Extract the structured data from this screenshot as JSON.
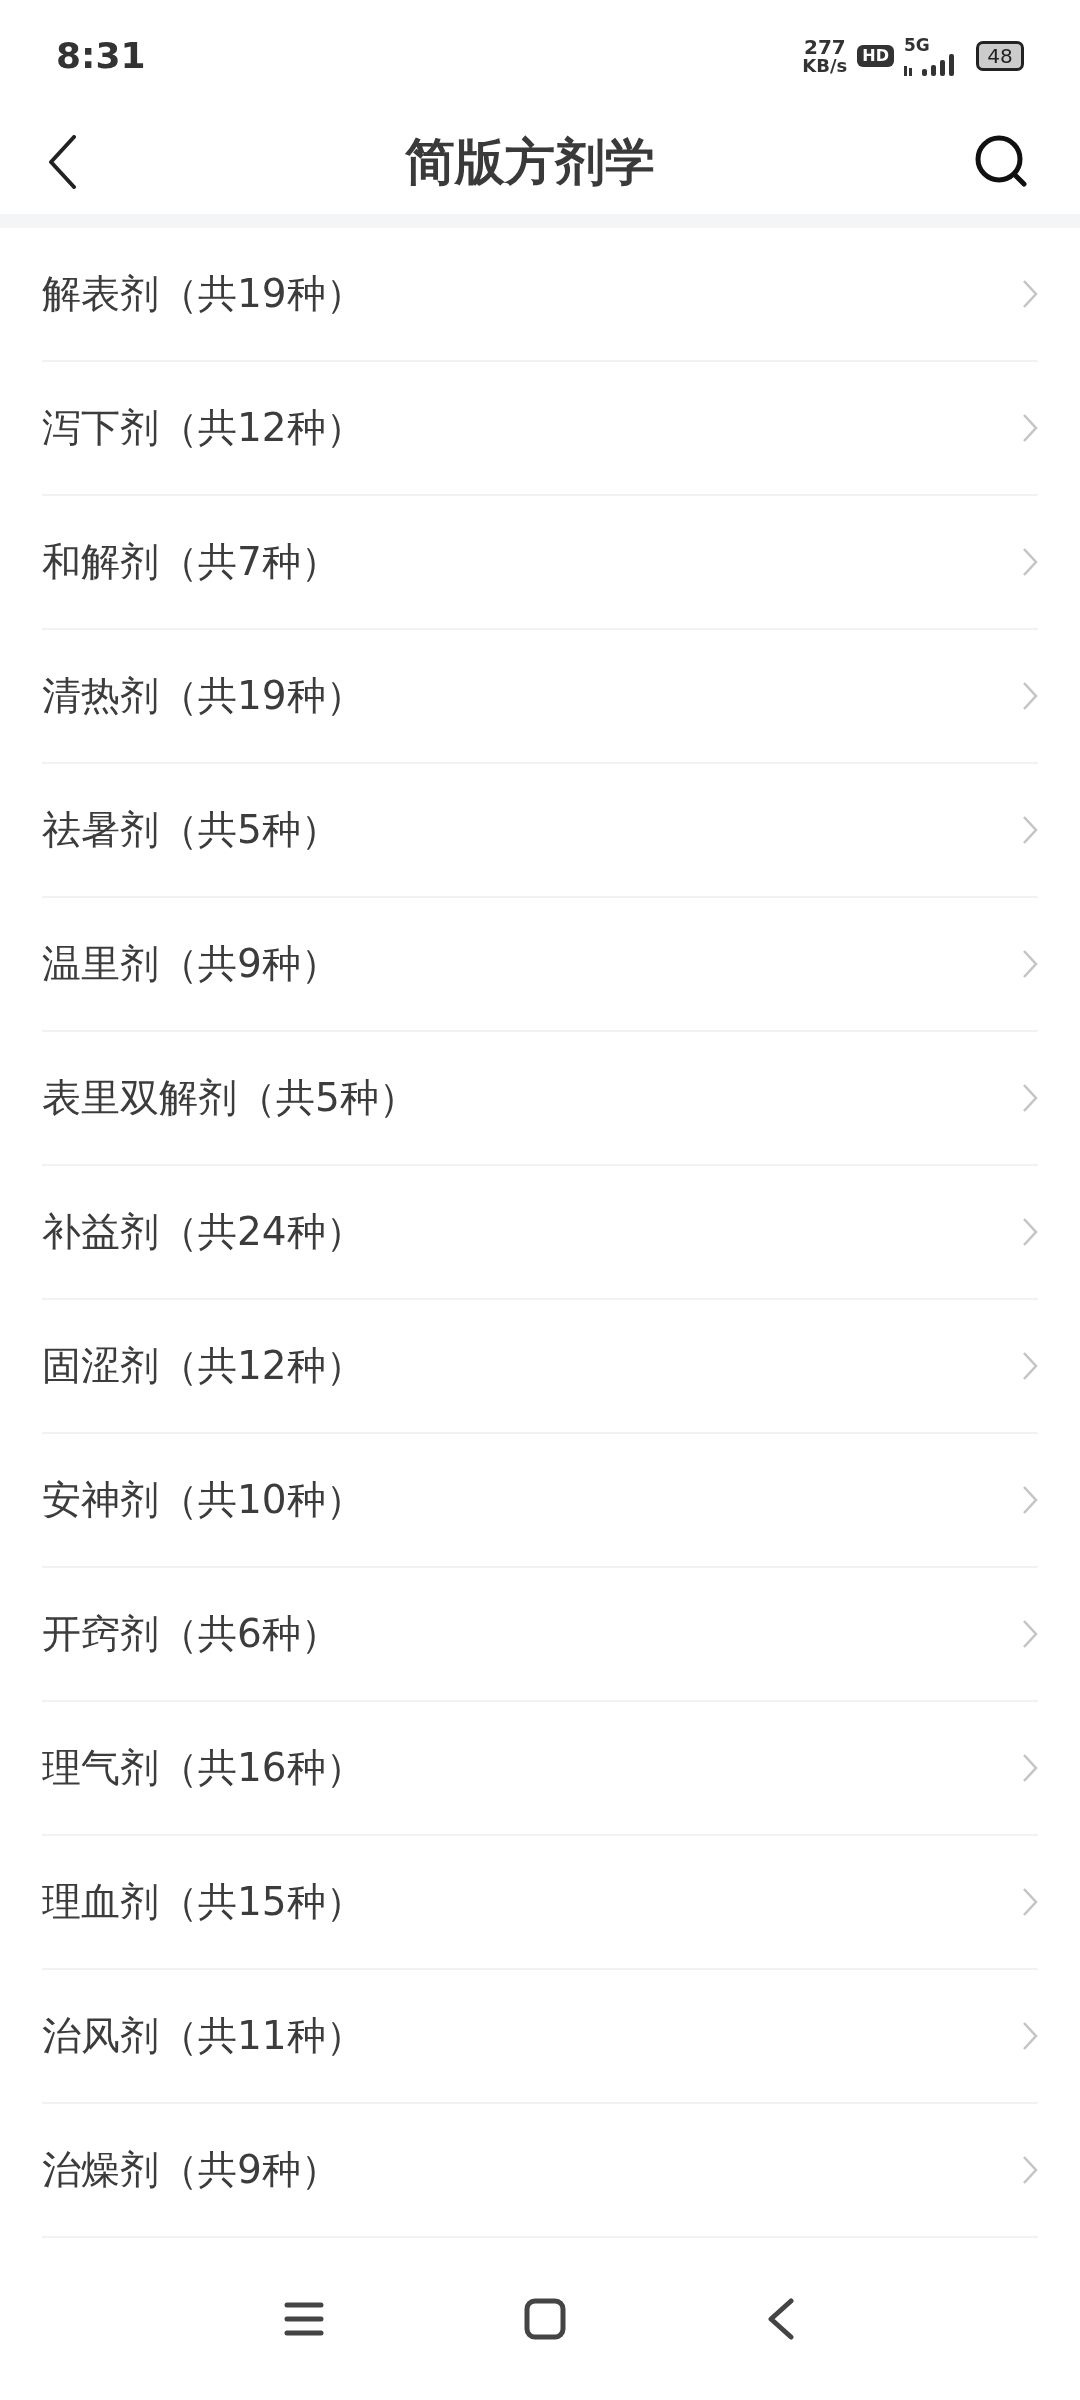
{
  "status_bar": {
    "time": "8:31",
    "speed_value": "277",
    "speed_unit": "KB/s",
    "hd": "HD",
    "network": "5G",
    "battery": "48"
  },
  "header": {
    "title": "简版方剂学"
  },
  "list": [
    {
      "label": "解表剂（共19种）"
    },
    {
      "label": "泻下剂（共12种）"
    },
    {
      "label": "和解剂（共7种）"
    },
    {
      "label": "清热剂（共19种）"
    },
    {
      "label": "祛暑剂（共5种）"
    },
    {
      "label": "温里剂（共9种）"
    },
    {
      "label": "表里双解剂（共5种）"
    },
    {
      "label": "补益剂（共24种）"
    },
    {
      "label": "固涩剂（共12种）"
    },
    {
      "label": "安神剂（共10种）"
    },
    {
      "label": "开窍剂（共6种）"
    },
    {
      "label": "理气剂（共16种）"
    },
    {
      "label": "理血剂（共15种）"
    },
    {
      "label": "治风剂（共11种）"
    },
    {
      "label": "治燥剂（共9种）"
    }
  ]
}
